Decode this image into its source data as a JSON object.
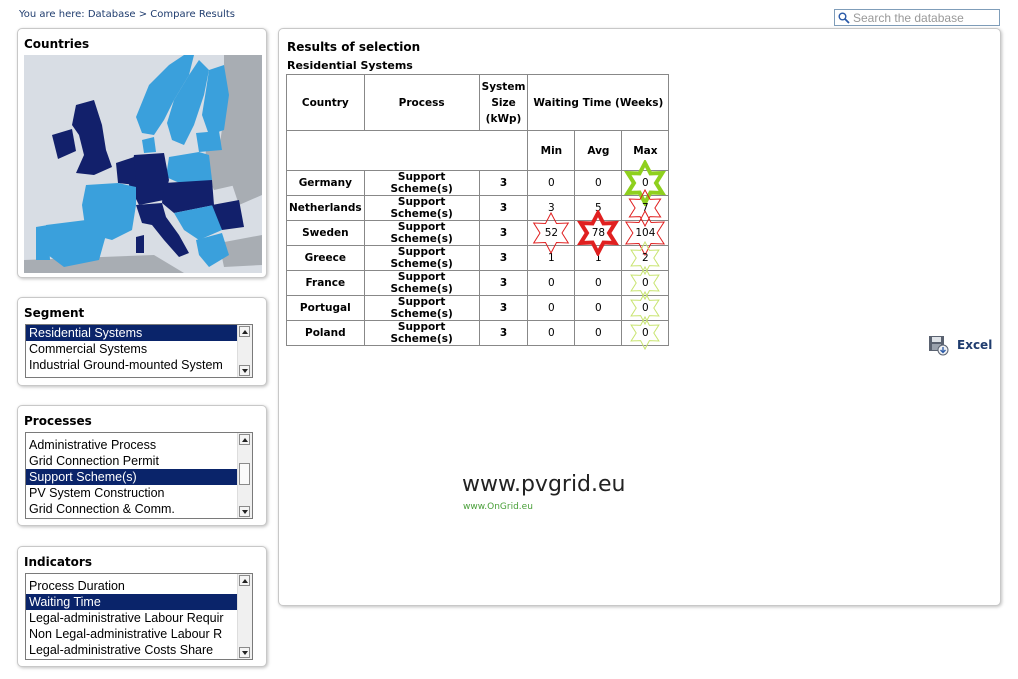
{
  "breadcrumb": "You are here: Database > Compare Results",
  "search": {
    "placeholder": "Search the database"
  },
  "colors": {
    "map_sea": "#d8dde4",
    "map_dark": "#12206b",
    "map_light": "#3aa0dc",
    "map_gray": "#a8adb3",
    "star_green": "#8fd01e",
    "star_red": "#e02020",
    "star_light": "#c8e470"
  },
  "countries_panel": {
    "title": "Countries"
  },
  "segment": {
    "title": "Segment",
    "options": [
      "Residential Systems",
      "Commercial Systems",
      "Industrial Ground-mounted System"
    ],
    "selected": 0
  },
  "processes": {
    "title": "Processes",
    "options": [
      "Administrative Process",
      "Grid Connection Permit",
      "Support Scheme(s)",
      "PV System Construction",
      "Grid Connection & Comm."
    ],
    "selected": 2
  },
  "indicators": {
    "title": "Indicators",
    "options": [
      "Process Duration",
      "Waiting Time",
      "Legal-administrative Labour Requir",
      "Non Legal-administrative Labour R",
      "Legal-administrative Costs Share"
    ],
    "selected": 1
  },
  "results": {
    "title": "Results of selection",
    "subtitle": "Residential Systems",
    "headers": {
      "country": "Country",
      "process": "Process",
      "size": "System Size (kWp)",
      "waiting": "Waiting Time (Weeks)",
      "min": "Min",
      "avg": "Avg",
      "max": "Max"
    },
    "rows": [
      {
        "country": "Germany",
        "process": "Support Scheme(s)",
        "size": "3",
        "min": "0",
        "avg": "0",
        "max": "0"
      },
      {
        "country": "Netherlands",
        "process": "Support Scheme(s)",
        "size": "3",
        "min": "3",
        "avg": "5",
        "max": "7"
      },
      {
        "country": "Sweden",
        "process": "Support Scheme(s)",
        "size": "3",
        "min": "52",
        "avg": "78",
        "max": "104"
      },
      {
        "country": "Greece",
        "process": "Support Scheme(s)",
        "size": "3",
        "min": "1",
        "avg": "1",
        "max": "2"
      },
      {
        "country": "France",
        "process": "Support Scheme(s)",
        "size": "3",
        "min": "0",
        "avg": "0",
        "max": "0"
      },
      {
        "country": "Portugal",
        "process": "Support Scheme(s)",
        "size": "3",
        "min": "0",
        "avg": "0",
        "max": "0"
      },
      {
        "country": "Poland",
        "process": "Support Scheme(s)",
        "size": "3",
        "min": "0",
        "avg": "0",
        "max": "0"
      }
    ]
  },
  "excel_label": "Excel",
  "watermark": {
    "main": "www.pvgrid.eu",
    "sub": "www.OnGrid.eu"
  }
}
